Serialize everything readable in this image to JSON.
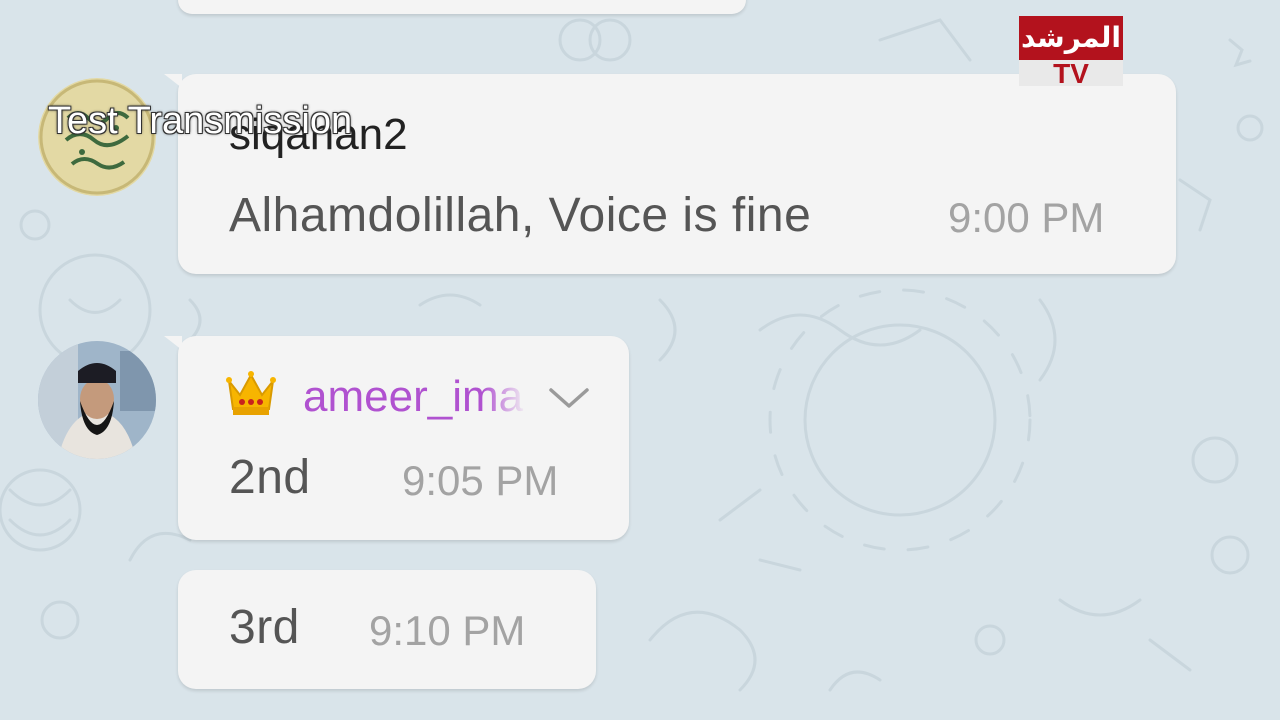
{
  "overlay": {
    "caption": "Test Transmission",
    "logo_top": "المرشد",
    "logo_bottom": "TV"
  },
  "messages": [
    {
      "sender": "siqahan2",
      "text": "Alhamdolillah, Voice is fine",
      "time": "9:00 PM",
      "avatar": "calligraphy-avatar"
    },
    {
      "sender": "ameer_ima",
      "sender_badge": "crown-emoji",
      "text": "2nd",
      "time": "9:05 PM",
      "avatar": "person-avatar"
    },
    {
      "text": "3rd",
      "time": "9:10 PM"
    }
  ],
  "colors": {
    "background": "#d9e4ea",
    "bubble": "#f4f4f4",
    "sender_purple": "#b052d0",
    "time_gray": "#a3a3a3",
    "logo_red": "#b3121d"
  }
}
